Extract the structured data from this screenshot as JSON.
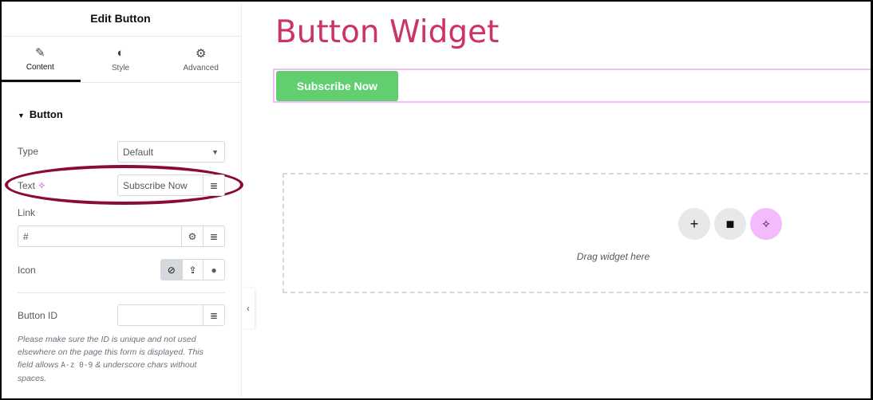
{
  "panel": {
    "title": "Edit Button",
    "tabs": [
      {
        "label": "Content",
        "icon": "pencil-icon",
        "active": true
      },
      {
        "label": "Style",
        "icon": "half-circle-icon"
      },
      {
        "label": "Advanced",
        "icon": "gear-icon"
      }
    ],
    "section": "Button",
    "type": {
      "label": "Type",
      "value": "Default"
    },
    "text": {
      "label": "Text",
      "value": "Subscribe Now"
    },
    "link": {
      "label": "Link",
      "value": "#"
    },
    "icon": {
      "label": "Icon",
      "options": [
        "none",
        "upload",
        "circle"
      ],
      "selected": "none"
    },
    "button_id": {
      "label": "Button ID",
      "value": ""
    },
    "hint": {
      "part1": "Please make sure the ID is unique and not used elsewhere on the page this form is displayed. This field allows ",
      "code": "A-z 0-9",
      "part2": " & underscore chars without spaces."
    }
  },
  "canvas": {
    "heading": "Button Widget",
    "button_label": "Subscribe Now",
    "drop_text": "Drag widget here"
  },
  "colors": {
    "heading": "#cc3366",
    "button": "#61ce70",
    "highlight": "#8b0a3c",
    "ai": "#f3bafd"
  }
}
